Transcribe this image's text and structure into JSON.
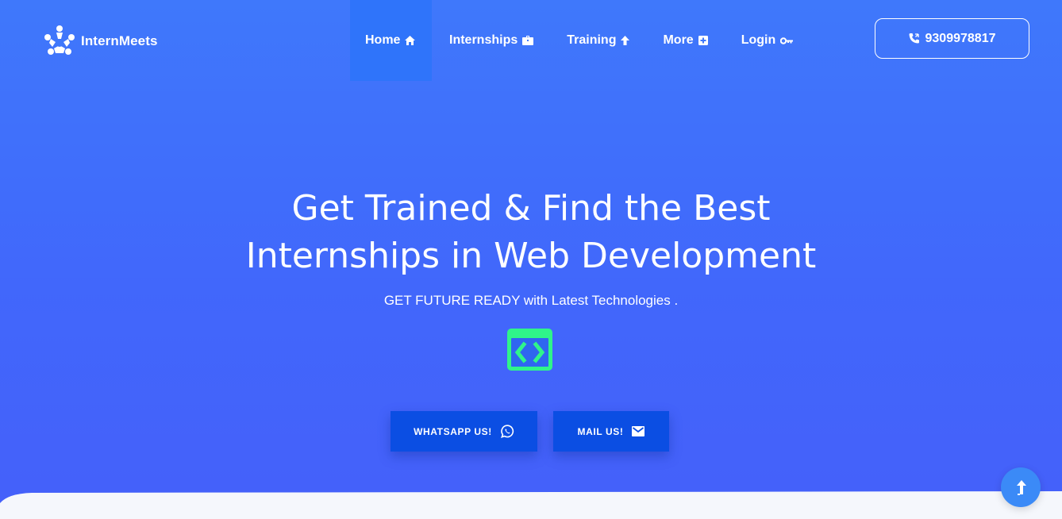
{
  "brand": {
    "name": "InternMeets",
    "logo_icon": "people-circle-logo"
  },
  "nav": {
    "items": [
      {
        "label": "Home",
        "icon": "home-icon"
      },
      {
        "label": "Internships",
        "icon": "briefcase-icon"
      },
      {
        "label": "Training",
        "icon": "arrow-up-icon"
      },
      {
        "label": "More",
        "icon": "plus-square-icon"
      },
      {
        "label": "Login",
        "icon": "key-icon"
      }
    ],
    "active": "Home"
  },
  "contact": {
    "phone": "9309978817",
    "icon": "phone-icon"
  },
  "hero": {
    "title_line1": "Get Trained & Find the Best",
    "title_line2": "Internships in Web Development",
    "subtitle": "GET FUTURE READY with Latest Technologies .",
    "feature_icon": "code-window-icon"
  },
  "cta": {
    "whatsapp_label": "WHATSAPP US!",
    "whatsapp_icon": "whatsapp-icon",
    "mail_label": "MAIL US!",
    "mail_icon": "mail-icon"
  },
  "scroll_top": {
    "icon": "arrow-up-icon"
  },
  "colors": {
    "background_top": "#3f78fb",
    "background_bottom": "#4560fa",
    "active_nav": "#2f74fa",
    "cta_button": "#0b4ee3",
    "code_icon": "#2ff58a",
    "scroll_top": "#3b8af7"
  }
}
